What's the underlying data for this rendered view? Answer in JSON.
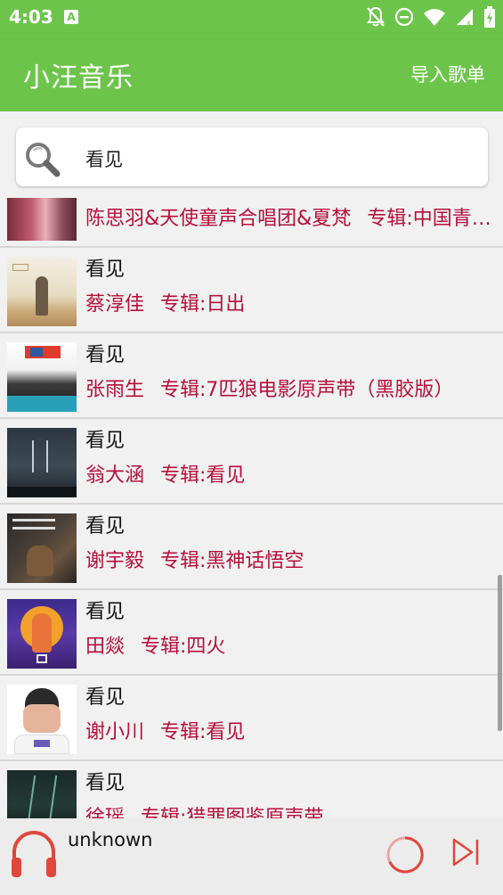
{
  "status_bar": {
    "time": "4:03",
    "badge": "A"
  },
  "app_bar": {
    "title": "小汪音乐",
    "import_label": "导入歌单"
  },
  "search": {
    "query": "看见"
  },
  "results": [
    {
      "song": "",
      "artist": "陈思羽&天使童声合唱团&夏梵",
      "album": "专辑:中国青…"
    },
    {
      "song": "看见",
      "artist": "蔡淳佳",
      "album": "专辑:日出"
    },
    {
      "song": "看见",
      "artist": "张雨生",
      "album": "专辑:7匹狼电影原声带（黑胶版）"
    },
    {
      "song": "看见",
      "artist": "翁大涵",
      "album": "专辑:看见"
    },
    {
      "song": "看见",
      "artist": "谢宇毅",
      "album": "专辑:黑神话悟空"
    },
    {
      "song": "看见",
      "artist": "田燚",
      "album": "专辑:四火"
    },
    {
      "song": "看见",
      "artist": "谢小川",
      "album": "专辑:看见"
    },
    {
      "song": "看见",
      "artist": "徐瑶",
      "album": "专辑:猎罪图鉴原声带"
    }
  ],
  "player": {
    "track": "unknown"
  },
  "colors": {
    "primary": "#6cc54a",
    "accent": "#b5103a",
    "player_icon": "#e0463b"
  }
}
